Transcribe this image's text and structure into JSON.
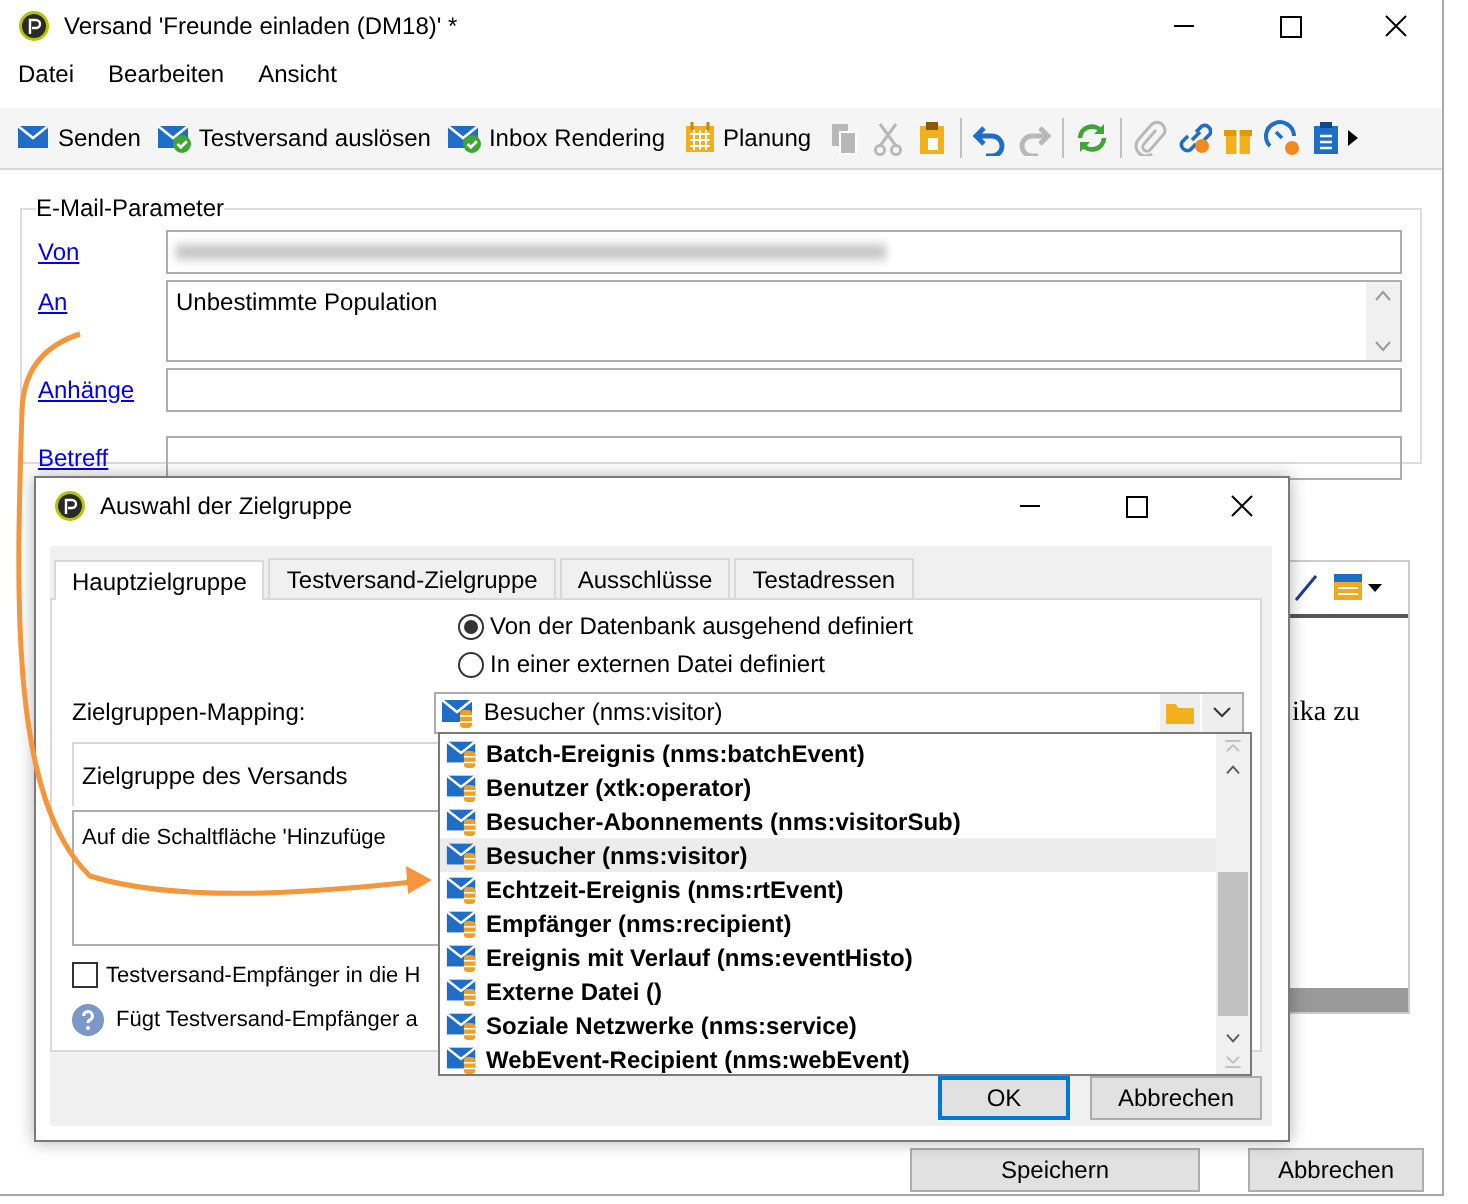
{
  "window": {
    "title": "Versand 'Freunde einladen (DM18)' *"
  },
  "menu": [
    "Datei",
    "Bearbeiten",
    "Ansicht"
  ],
  "toolbar": [
    {
      "kind": "send",
      "label": "Senden"
    },
    {
      "kind": "test",
      "label": "Testversand auslösen"
    },
    {
      "kind": "test",
      "label": "Inbox Rendering"
    },
    {
      "kind": "calendar",
      "label": "Planung"
    },
    {
      "kind": "copy",
      "disabled": true
    },
    {
      "kind": "cut",
      "disabled": true
    },
    {
      "kind": "paste",
      "disabled": false
    },
    {
      "kind": "separator"
    },
    {
      "kind": "undo",
      "disabled": false
    },
    {
      "kind": "redo",
      "disabled": true
    },
    {
      "kind": "separator"
    },
    {
      "kind": "refresh",
      "disabled": false
    },
    {
      "kind": "separator"
    },
    {
      "kind": "attach",
      "disabled": true
    },
    {
      "kind": "link",
      "disabled": false
    },
    {
      "kind": "gift",
      "disabled": false
    },
    {
      "kind": "gauge",
      "disabled": false
    },
    {
      "kind": "clipboard",
      "disabled": false
    },
    {
      "kind": "more"
    }
  ],
  "email_parameters": {
    "title": "E-Mail-Parameter",
    "fields": [
      {
        "kind": "blurred",
        "label": "Von"
      },
      {
        "kind": "textarea",
        "label": "An",
        "value": "Unbestimmte Population"
      },
      {
        "kind": "text",
        "label": "Anhänge"
      },
      {
        "kind": "text",
        "label": "Betreff"
      }
    ]
  },
  "content_preview": {
    "text": "ika zu"
  },
  "buttons": [
    "Speichern",
    "Abbrechen"
  ],
  "dialog": {
    "title": "Auswahl der Zielgruppe",
    "tabs": [
      {
        "label": "Hauptzielgruppe",
        "selected": true
      },
      {
        "label": "Testversand-Zielgruppe",
        "selected": false
      },
      {
        "label": "Ausschlüsse",
        "selected": false
      },
      {
        "label": "Testadressen",
        "selected": false
      }
    ],
    "radios": [
      {
        "label": "Von der Datenbank ausgehend definiert",
        "selected": true
      },
      {
        "label": "In einer externen Datei definiert",
        "selected": false
      }
    ],
    "mapping": {
      "label": "Zielgruppen-Mapping:",
      "value": "Besucher (nms:visitor)"
    },
    "target_group": {
      "title": "Zielgruppe des Versands",
      "text": "Auf die Schaltfläche 'Hinzufüge"
    },
    "checkbox": {
      "label": "Testversand-Empfänger in die H",
      "checked": false
    },
    "help": "Fügt Testversand-Empfänger a",
    "buttons": [
      "OK",
      "Abbrechen"
    ]
  },
  "dropdown": {
    "items": [
      {
        "label": "Batch-Ereignis (nms:batchEvent)",
        "selected": false
      },
      {
        "label": "Benutzer (xtk:operator)",
        "selected": false
      },
      {
        "label": "Besucher-Abonnements (nms:visitorSub)",
        "selected": false
      },
      {
        "label": "Besucher (nms:visitor)",
        "selected": true
      },
      {
        "label": "Echtzeit-Ereignis (nms:rtEvent)",
        "selected": false
      },
      {
        "label": "Empfänger (nms:recipient)",
        "selected": false
      },
      {
        "label": "Ereignis mit Verlauf (nms:eventHisto)",
        "selected": false
      },
      {
        "label": "Externe Datei ()",
        "selected": false
      },
      {
        "label": "Soziale Netzwerke (nms:service)",
        "selected": false
      },
      {
        "label": "WebEvent-Recipient (nms:webEvent)",
        "selected": false
      }
    ]
  }
}
